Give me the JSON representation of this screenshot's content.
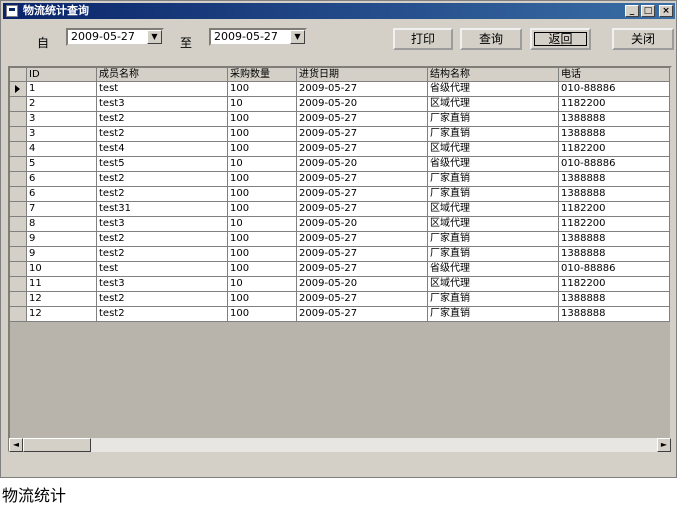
{
  "window": {
    "title": "物流统计查询",
    "controls": [
      "_",
      "□",
      "×"
    ]
  },
  "filters": {
    "from_label": "自",
    "from_date": "2009-05-27",
    "to_label": "至",
    "to_date": "2009-05-27",
    "dropdown_glyph": "▼"
  },
  "buttons": {
    "print": "打印",
    "query": "查询",
    "back": "返回",
    "close": "关闭"
  },
  "grid": {
    "columns": [
      "ID",
      "成员名称",
      "采购数量",
      "进货日期",
      "结构名称",
      "电话"
    ],
    "rows": [
      [
        "1",
        "test",
        "100",
        "2009-05-27",
        "省级代理",
        "010-88886"
      ],
      [
        "2",
        "test3",
        "10",
        "2009-05-20",
        "区域代理",
        "1182200"
      ],
      [
        "3",
        "test2",
        "100",
        "2009-05-27",
        "厂家直销",
        "1388888"
      ],
      [
        "3",
        "test2",
        "100",
        "2009-05-27",
        "厂家直销",
        "1388888"
      ],
      [
        "4",
        "test4",
        "100",
        "2009-05-27",
        "区域代理",
        "1182200"
      ],
      [
        "5",
        "test5",
        "10",
        "2009-05-20",
        "省级代理",
        "010-88886"
      ],
      [
        "6",
        "test2",
        "100",
        "2009-05-27",
        "厂家直销",
        "1388888"
      ],
      [
        "6",
        "test2",
        "100",
        "2009-05-27",
        "厂家直销",
        "1388888"
      ],
      [
        "7",
        "test31",
        "100",
        "2009-05-27",
        "区域代理",
        "1182200"
      ],
      [
        "8",
        "test3",
        "10",
        "2009-05-20",
        "区域代理",
        "1182200"
      ],
      [
        "9",
        "test2",
        "100",
        "2009-05-27",
        "厂家直销",
        "1388888"
      ],
      [
        "9",
        "test2",
        "100",
        "2009-05-27",
        "厂家直销",
        "1388888"
      ],
      [
        "10",
        "test",
        "100",
        "2009-05-27",
        "省级代理",
        "010-88886"
      ],
      [
        "11",
        "test3",
        "10",
        "2009-05-20",
        "区域代理",
        "1182200"
      ],
      [
        "12",
        "test2",
        "100",
        "2009-05-27",
        "厂家直销",
        "1388888"
      ],
      [
        "12",
        "test2",
        "100",
        "2009-05-27",
        "厂家直销",
        "1388888"
      ]
    ],
    "selected_row": 0
  },
  "scrollbar": {
    "left": "◄",
    "right": "►"
  },
  "caption": "物流统计"
}
